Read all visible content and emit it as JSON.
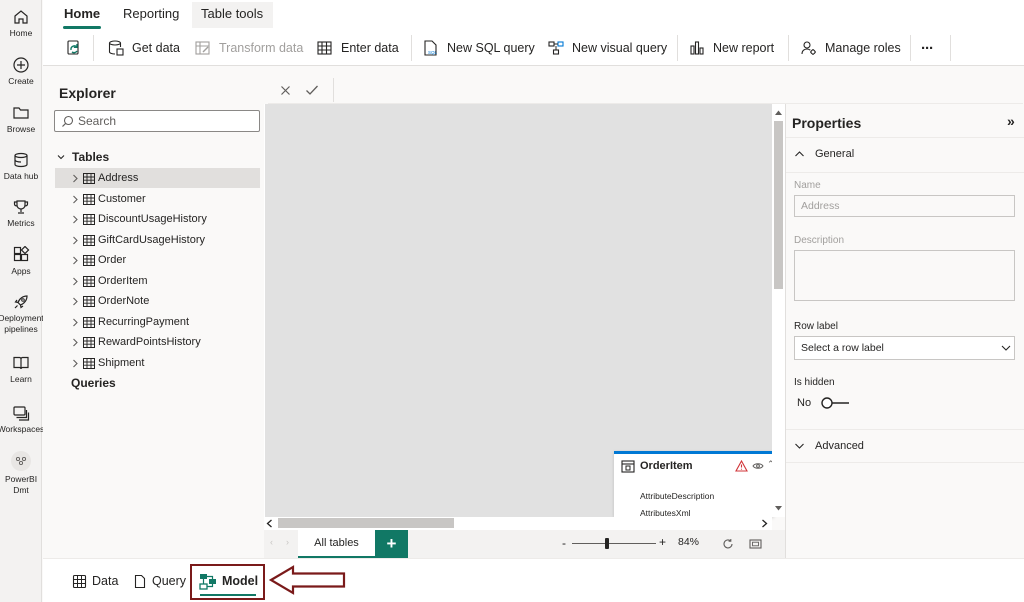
{
  "leftnav": {
    "items": [
      {
        "label": "Home",
        "icon": "home-icon"
      },
      {
        "label": "Create",
        "icon": "plus-circle-icon"
      },
      {
        "label": "Browse",
        "icon": "folder-icon"
      },
      {
        "label": "Data hub",
        "icon": "database-icon"
      },
      {
        "label": "Metrics",
        "icon": "trophy-icon"
      },
      {
        "label": "Apps",
        "icon": "apps-icon"
      },
      {
        "label_line1": "Deployment",
        "label_line2": "pipelines",
        "icon": "rocket-icon"
      },
      {
        "label": "Learn",
        "icon": "book-icon"
      },
      {
        "label": "Workspaces",
        "icon": "workspaces-icon"
      },
      {
        "label_line1": "PowerBI",
        "label_line2": "Dmt",
        "icon": "workspace-avatar-icon"
      }
    ]
  },
  "ribbon": {
    "tabs": [
      "Home",
      "Reporting",
      "Table tools"
    ],
    "buttons": {
      "get_data": "Get data",
      "transform_data": "Transform data",
      "enter_data": "Enter data",
      "new_sql_query": "New SQL query",
      "new_visual_query": "New visual query",
      "new_report": "New report",
      "manage_roles": "Manage roles",
      "more": "···"
    }
  },
  "explorer": {
    "title": "Explorer",
    "search_placeholder": "Search",
    "tables_label": "Tables",
    "tables": [
      "Address",
      "Customer",
      "DiscountUsageHistory",
      "GiftCardUsageHistory",
      "Order",
      "OrderItem",
      "OrderNote",
      "RecurringPayment",
      "RewardPointsHistory",
      "Shipment"
    ],
    "selected": "Address",
    "queries_label": "Queries"
  },
  "canvas": {
    "table_card": {
      "name": "OrderItem",
      "columns": [
        "AttributeDescription",
        "AttributesXml"
      ]
    },
    "tabs": {
      "all_tables": "All tables",
      "add": "+"
    },
    "zoom": {
      "minus": "-",
      "plus": "+",
      "value": "84%",
      "level": 0.84
    }
  },
  "properties": {
    "title": "Properties",
    "collapse": "»",
    "general": "General",
    "name_label": "Name",
    "name_value": "Address",
    "description_label": "Description",
    "row_label_label": "Row label",
    "row_label_placeholder": "Select a row label",
    "is_hidden_label": "Is hidden",
    "is_hidden_value": "No",
    "advanced": "Advanced"
  },
  "bottom_tabs": {
    "data": "Data",
    "query": "Query",
    "model": "Model",
    "active": "Model"
  },
  "colors": {
    "accent": "#117865",
    "highlight_border": "#7a1a1a",
    "canvas": "#e1e1e1",
    "card_top": "#0078d4",
    "warning": "#d13438"
  }
}
